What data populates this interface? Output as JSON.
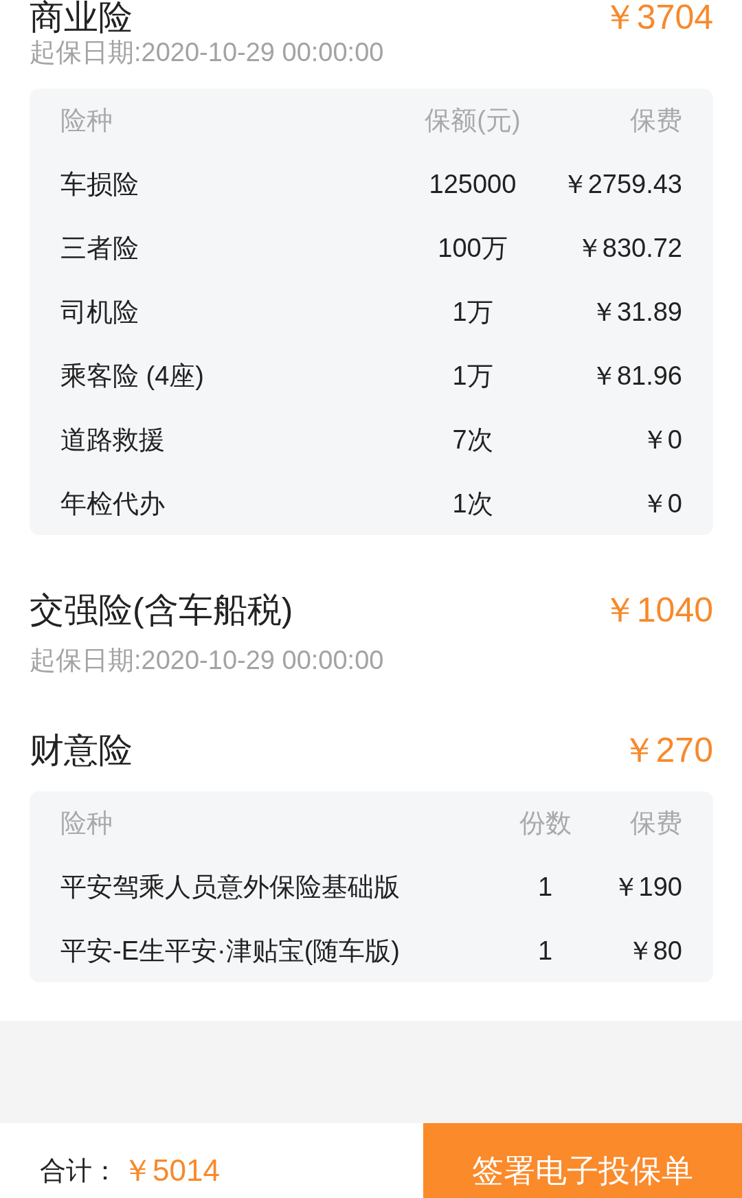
{
  "sections": [
    {
      "title": "商业险",
      "amount": "￥3704",
      "start_date": "起保日期:2020-10-29 00:00:00",
      "table": {
        "columns": [
          "险种",
          "保额(元)",
          "保费"
        ],
        "rows": [
          [
            "车损险",
            "125000",
            "￥2759.43"
          ],
          [
            "三者险",
            "100万",
            "￥830.72"
          ],
          [
            "司机险",
            "1万",
            "￥31.89"
          ],
          [
            "乘客险 (4座)",
            "1万",
            "￥81.96"
          ],
          [
            "道路救援",
            "7次",
            "￥0"
          ],
          [
            "年检代办",
            "1次",
            "￥0"
          ]
        ]
      }
    },
    {
      "title": "交强险(含车船税)",
      "amount": "￥1040",
      "start_date": "起保日期:2020-10-29 00:00:00"
    },
    {
      "title": "财意险",
      "amount": "￥270",
      "table": {
        "columns": [
          "险种",
          "份数",
          "保费"
        ],
        "rows": [
          [
            "平安驾乘人员意外保险基础版",
            "1",
            "￥190"
          ],
          [
            "平安-E生平安·津贴宝(随车版)",
            "1",
            "￥80"
          ]
        ]
      }
    }
  ],
  "footer": {
    "total_label": "合计：",
    "total_amount": "￥5014",
    "button": "签署电子投保单"
  }
}
